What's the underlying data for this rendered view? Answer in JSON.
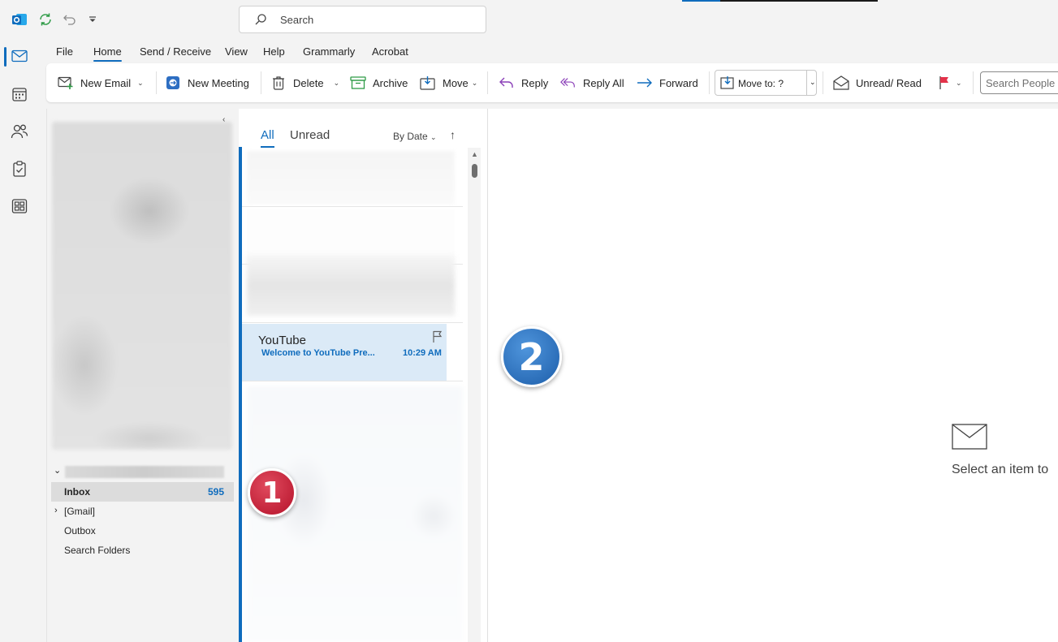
{
  "titlebar": {
    "search_placeholder": "Search",
    "icons": [
      "outlook-app-icon",
      "sync-icon",
      "undo-icon",
      "customize-toolbar-icon"
    ]
  },
  "rail": {
    "items": [
      {
        "name": "mail",
        "icon": "mail-icon",
        "active": true
      },
      {
        "name": "calendar",
        "icon": "calendar-icon",
        "active": false
      },
      {
        "name": "people",
        "icon": "people-icon",
        "active": false
      },
      {
        "name": "tasks",
        "icon": "tasks-icon",
        "active": false
      },
      {
        "name": "apps",
        "icon": "apps-icon",
        "active": false
      }
    ]
  },
  "menu": {
    "tabs": [
      "File",
      "Home",
      "Send / Receive",
      "View",
      "Help",
      "Grammarly",
      "Acrobat"
    ],
    "active": "Home"
  },
  "ribbon": {
    "new_email": "New Email",
    "new_meeting": "New Meeting",
    "delete": "Delete",
    "archive": "Archive",
    "move": "Move",
    "reply": "Reply",
    "reply_all": "Reply All",
    "forward": "Forward",
    "move_to": "Move to: ?",
    "unread_read": "Unread/ Read",
    "search_people_placeholder": "Search People"
  },
  "folders": {
    "items": [
      {
        "label": "Inbox",
        "count": "595",
        "selected": true
      },
      {
        "label": "[Gmail]",
        "count": "",
        "selected": false,
        "expandable": true
      },
      {
        "label": "Outbox",
        "count": "",
        "selected": false
      },
      {
        "label": "Search Folders",
        "count": "",
        "selected": false
      }
    ]
  },
  "message_list": {
    "filter_all": "All",
    "filter_unread": "Unread",
    "sort_label": "By Date",
    "selected_message": {
      "sender": "YouTube",
      "subject": "Welcome to YouTube Pre...",
      "time": "10:29 AM"
    }
  },
  "reading_pane": {
    "empty_text": "Select an item to"
  },
  "callouts": {
    "one": "1",
    "two": "2"
  },
  "colors": {
    "accent": "#0f6cbd",
    "selected_item_bg": "#dbeaf7",
    "callout_red": "#c8182f",
    "callout_blue": "#2a6fbe"
  }
}
